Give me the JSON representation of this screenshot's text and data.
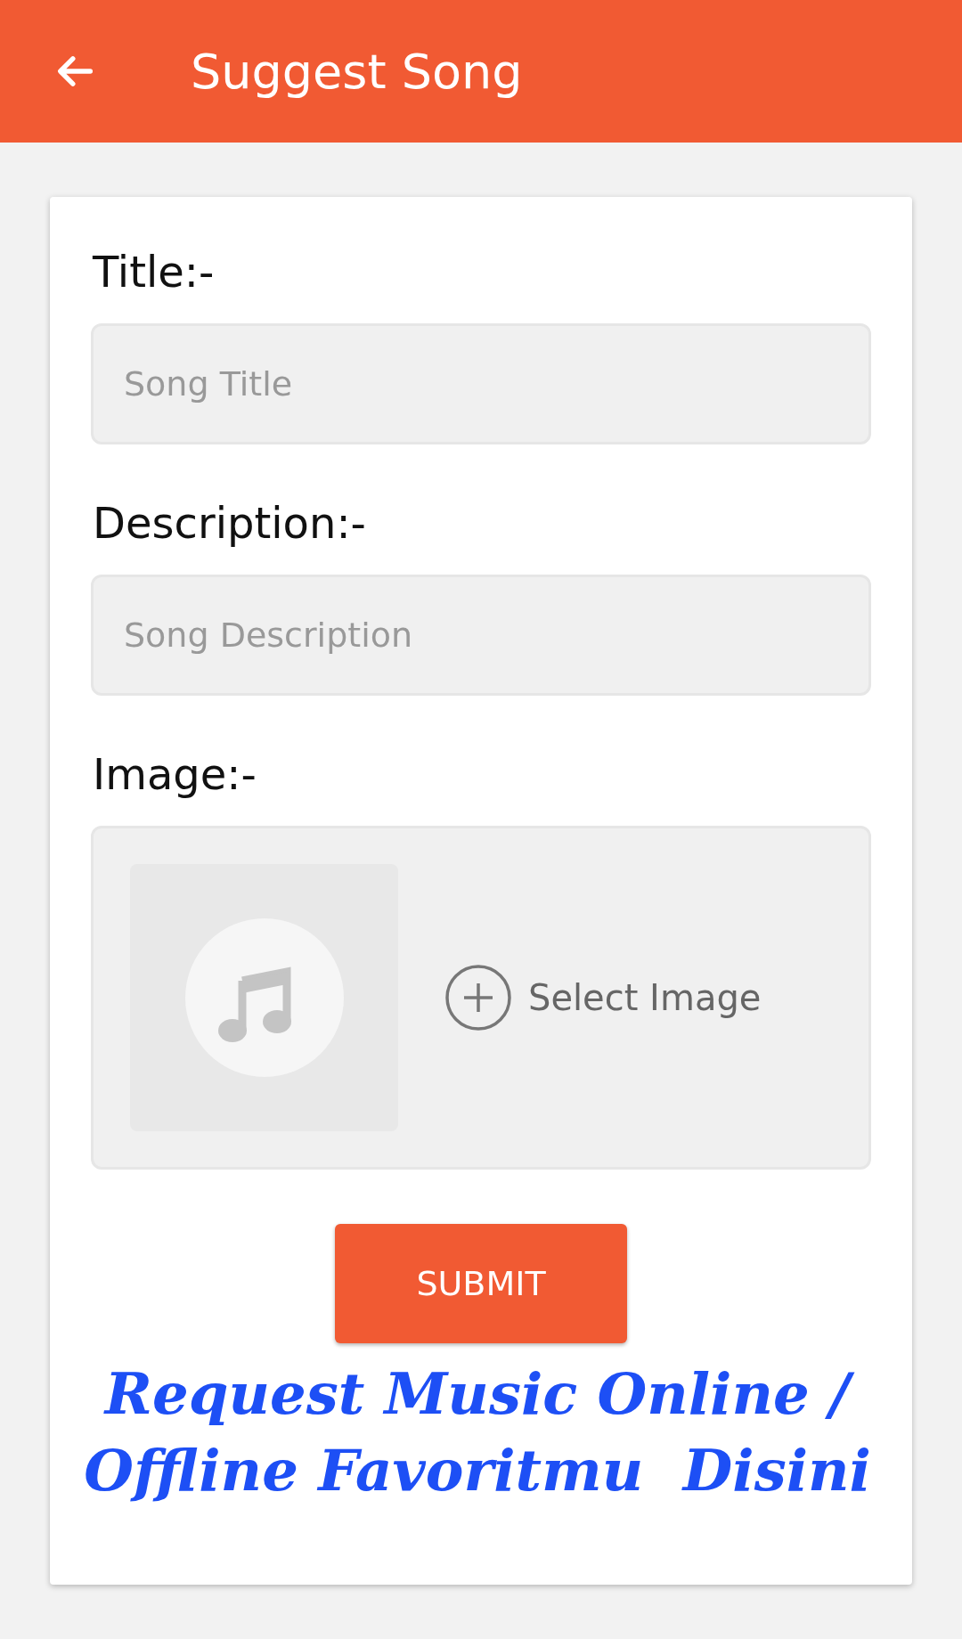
{
  "app_bar": {
    "title": "Suggest Song"
  },
  "fields": [
    {
      "label": "Title:-",
      "placeholder": "Song Title"
    },
    {
      "label": "Description:-",
      "placeholder": "Song Description"
    }
  ],
  "image": {
    "label": "Image:-",
    "action": "Select Image"
  },
  "submit": "SUBMIT",
  "promo": [
    "Request Music Online /",
    "Offline Favoritmu  Disini"
  ]
}
